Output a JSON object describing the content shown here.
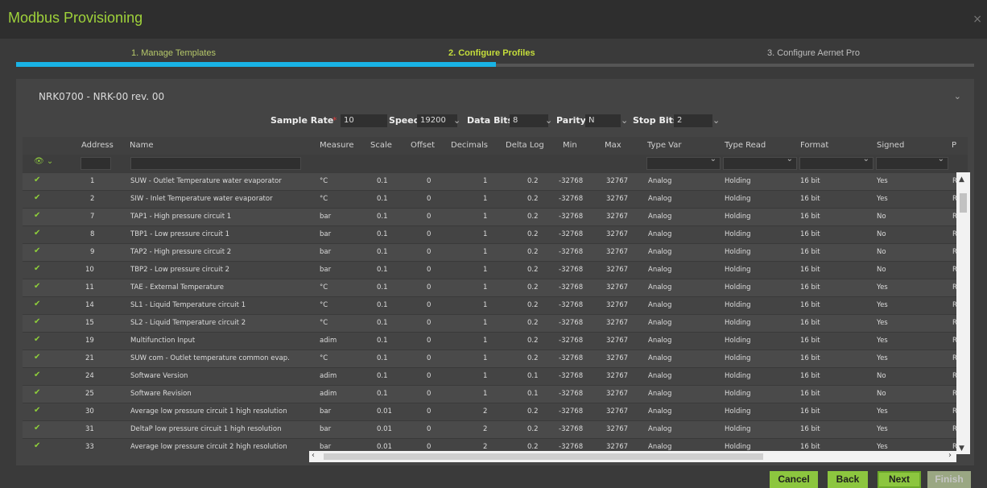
{
  "window": {
    "title": "Modbus Provisioning",
    "close_glyph": "×"
  },
  "steps": [
    {
      "label": "1. Manage Templates"
    },
    {
      "label": "2. Configure Profiles"
    },
    {
      "label": "3. Configure Aernet Pro"
    }
  ],
  "device": {
    "selected": "NRK0700 - NRK-00 rev. 00"
  },
  "params": {
    "sample_rate_label": "Sample Rate",
    "sample_rate_required": "*",
    "sample_rate_value": "10",
    "speed_label": "Speed",
    "speed_value": "19200",
    "data_bits_label": "Data Bits",
    "data_bits_value": "8",
    "parity_label": "Parity",
    "parity_value": "N",
    "stop_bits_label": "Stop Bits",
    "stop_bits_value": "2"
  },
  "table": {
    "headers": {
      "visible": "",
      "address": "Address",
      "name": "Name",
      "measure": "Measure",
      "scale": "Scale",
      "offset": "Offset",
      "decimals": "Decimals",
      "delta_log": "Delta Log",
      "min": "Min",
      "max": "Max",
      "type_var": "Type Var",
      "type_read": "Type Read",
      "format": "Format",
      "signed": "Signed",
      "extra": "P"
    },
    "rows": [
      {
        "address": "1",
        "name": "SUW - Outlet Temperature water evaporator",
        "measure": "°C",
        "scale": "0.1",
        "offset": "0",
        "decimals": "1",
        "delta_log": "0.2",
        "min": "-32768",
        "max": "32767",
        "type_var": "Analog",
        "type_read": "Holding",
        "format": "16 bit",
        "signed": "Yes",
        "extra": "R"
      },
      {
        "address": "2",
        "name": "SIW - Inlet Temperature water evaporator",
        "measure": "°C",
        "scale": "0.1",
        "offset": "0",
        "decimals": "1",
        "delta_log": "0.2",
        "min": "-32768",
        "max": "32767",
        "type_var": "Analog",
        "type_read": "Holding",
        "format": "16 bit",
        "signed": "Yes",
        "extra": "R"
      },
      {
        "address": "7",
        "name": "TAP1 - High pressure circuit 1",
        "measure": "bar",
        "scale": "0.1",
        "offset": "0",
        "decimals": "1",
        "delta_log": "0.2",
        "min": "-32768",
        "max": "32767",
        "type_var": "Analog",
        "type_read": "Holding",
        "format": "16 bit",
        "signed": "No",
        "extra": "R"
      },
      {
        "address": "8",
        "name": "TBP1 - Low pressure circuit 1",
        "measure": "bar",
        "scale": "0.1",
        "offset": "0",
        "decimals": "1",
        "delta_log": "0.2",
        "min": "-32768",
        "max": "32767",
        "type_var": "Analog",
        "type_read": "Holding",
        "format": "16 bit",
        "signed": "No",
        "extra": "R"
      },
      {
        "address": "9",
        "name": "TAP2 - High pressure circuit 2",
        "measure": "bar",
        "scale": "0.1",
        "offset": "0",
        "decimals": "1",
        "delta_log": "0.2",
        "min": "-32768",
        "max": "32767",
        "type_var": "Analog",
        "type_read": "Holding",
        "format": "16 bit",
        "signed": "No",
        "extra": "R"
      },
      {
        "address": "10",
        "name": "TBP2 - Low pressure circuit 2",
        "measure": "bar",
        "scale": "0.1",
        "offset": "0",
        "decimals": "1",
        "delta_log": "0.2",
        "min": "-32768",
        "max": "32767",
        "type_var": "Analog",
        "type_read": "Holding",
        "format": "16 bit",
        "signed": "No",
        "extra": "R"
      },
      {
        "address": "11",
        "name": "TAE - External Temperature",
        "measure": "°C",
        "scale": "0.1",
        "offset": "0",
        "decimals": "1",
        "delta_log": "0.2",
        "min": "-32768",
        "max": "32767",
        "type_var": "Analog",
        "type_read": "Holding",
        "format": "16 bit",
        "signed": "Yes",
        "extra": "R"
      },
      {
        "address": "14",
        "name": "SL1 - Liquid Temperature circuit 1",
        "measure": "°C",
        "scale": "0.1",
        "offset": "0",
        "decimals": "1",
        "delta_log": "0.2",
        "min": "-32768",
        "max": "32767",
        "type_var": "Analog",
        "type_read": "Holding",
        "format": "16 bit",
        "signed": "Yes",
        "extra": "R"
      },
      {
        "address": "15",
        "name": "SL2 - Liquid Temperature circuit 2",
        "measure": "°C",
        "scale": "0.1",
        "offset": "0",
        "decimals": "1",
        "delta_log": "0.2",
        "min": "-32768",
        "max": "32767",
        "type_var": "Analog",
        "type_read": "Holding",
        "format": "16 bit",
        "signed": "Yes",
        "extra": "R"
      },
      {
        "address": "19",
        "name": "Multifunction Input",
        "measure": "adim",
        "scale": "0.1",
        "offset": "0",
        "decimals": "1",
        "delta_log": "0.2",
        "min": "-32768",
        "max": "32767",
        "type_var": "Analog",
        "type_read": "Holding",
        "format": "16 bit",
        "signed": "Yes",
        "extra": "R"
      },
      {
        "address": "21",
        "name": "SUW com - Outlet temperature common evap.",
        "measure": "°C",
        "scale": "0.1",
        "offset": "0",
        "decimals": "1",
        "delta_log": "0.2",
        "min": "-32768",
        "max": "32767",
        "type_var": "Analog",
        "type_read": "Holding",
        "format": "16 bit",
        "signed": "Yes",
        "extra": "R"
      },
      {
        "address": "24",
        "name": "Software Version",
        "measure": "adim",
        "scale": "0.1",
        "offset": "0",
        "decimals": "1",
        "delta_log": "0.1",
        "min": "-32768",
        "max": "32767",
        "type_var": "Analog",
        "type_read": "Holding",
        "format": "16 bit",
        "signed": "No",
        "extra": "R"
      },
      {
        "address": "25",
        "name": "Software Revision",
        "measure": "adim",
        "scale": "0.1",
        "offset": "0",
        "decimals": "1",
        "delta_log": "0.1",
        "min": "-32768",
        "max": "32767",
        "type_var": "Analog",
        "type_read": "Holding",
        "format": "16 bit",
        "signed": "No",
        "extra": "R"
      },
      {
        "address": "30",
        "name": "Average low pressure circuit 1 high resolution",
        "measure": "bar",
        "scale": "0.01",
        "offset": "0",
        "decimals": "2",
        "delta_log": "0.2",
        "min": "-32768",
        "max": "32767",
        "type_var": "Analog",
        "type_read": "Holding",
        "format": "16 bit",
        "signed": "Yes",
        "extra": "R"
      },
      {
        "address": "31",
        "name": "DeltaP low pressure circuit 1 high resolution",
        "measure": "bar",
        "scale": "0.01",
        "offset": "0",
        "decimals": "2",
        "delta_log": "0.2",
        "min": "-32768",
        "max": "32767",
        "type_var": "Analog",
        "type_read": "Holding",
        "format": "16 bit",
        "signed": "Yes",
        "extra": "R"
      },
      {
        "address": "33",
        "name": "Average low pressure circuit 2 high resolution",
        "measure": "bar",
        "scale": "0.01",
        "offset": "0",
        "decimals": "2",
        "delta_log": "0.2",
        "min": "-32768",
        "max": "32767",
        "type_var": "Analog",
        "type_read": "Holding",
        "format": "16 bit",
        "signed": "Yes",
        "extra": "R"
      }
    ]
  },
  "buttons": {
    "cancel": "Cancel",
    "back": "Back",
    "next": "Next",
    "finish": "Finish"
  },
  "colors": {
    "accent_green": "#8cc63f",
    "progress_blue": "#19b3e5",
    "title_green": "#9fd23a"
  },
  "wizard_progress": 0.5
}
